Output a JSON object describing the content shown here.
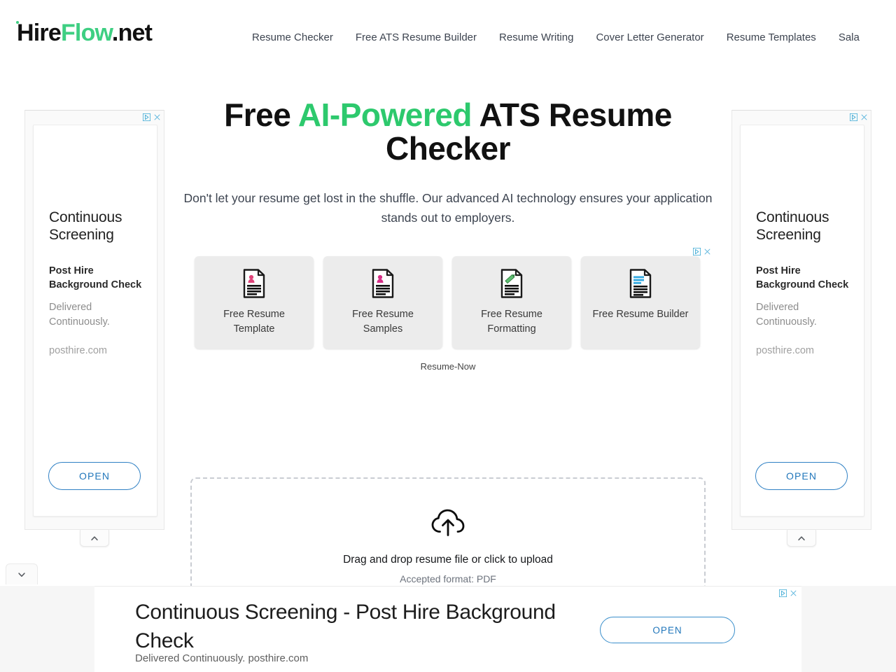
{
  "header": {
    "logo": {
      "pre": "Hire",
      "accent": "Flow",
      "suffix": ".net"
    },
    "nav": [
      {
        "label": "Resume Checker"
      },
      {
        "label": "Free ATS Resume Builder"
      },
      {
        "label": "Resume Writing"
      },
      {
        "label": "Cover Letter Generator"
      },
      {
        "label": "Resume Templates"
      },
      {
        "label": "Sala"
      }
    ]
  },
  "hero": {
    "title_part1": "Free ",
    "title_accent": "AI-Powered",
    "title_part2": " ATS Resume Checker",
    "subtitle": "Don't let your resume get lost in the shuffle. Our advanced AI technology ensures your application stands out to employers."
  },
  "side_ad": {
    "headline": "Continuous Screening",
    "subhead": "Post Hire Background Check",
    "description": "Delivered Continuously.",
    "url": "posthire.com",
    "cta": "OPEN"
  },
  "mid_ad": {
    "brand": "Resume-Now",
    "cards": [
      {
        "label": "Free Resume Template",
        "icon": "resume-document-person-icon",
        "accent": "#e0457b"
      },
      {
        "label": "Free Resume Samples",
        "icon": "resume-document-person-icon",
        "accent": "#d62f87"
      },
      {
        "label": "Free Resume Formatting",
        "icon": "resume-document-pencil-icon",
        "accent": "#43a047"
      },
      {
        "label": "Free Resume Builder",
        "icon": "resume-document-lines-icon",
        "accent": "#34a9e0"
      }
    ]
  },
  "upload": {
    "primary_text": "Drag and drop resume file or click to upload",
    "secondary_text": "Accepted format: PDF",
    "icon": "cloud-upload-icon"
  },
  "bottom_ad": {
    "headline": "Continuous Screening - Post Hire Background Check",
    "description": "Delivered Continuously. posthire.com",
    "cta": "OPEN"
  },
  "colors": {
    "brand_green": "#3ecf82",
    "hero_accent": "#2dc96d",
    "ad_link_blue": "#2277bb",
    "adchoices_blue": "#3ba9d4"
  }
}
